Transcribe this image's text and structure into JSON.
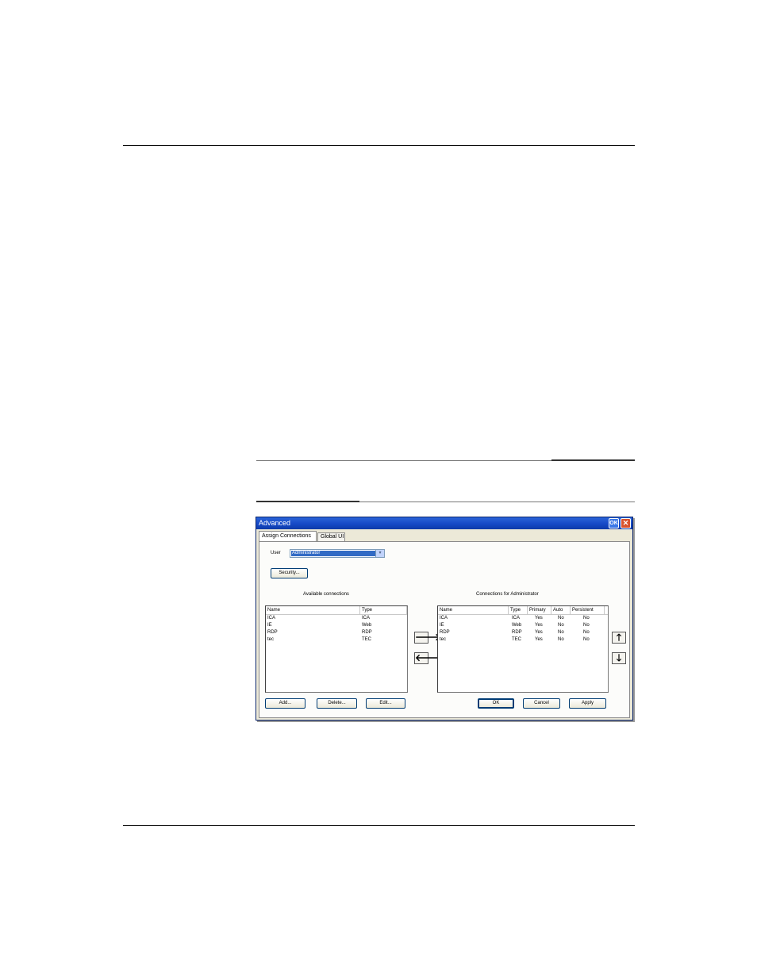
{
  "dialog": {
    "title": "Advanced",
    "ok_label": "OK",
    "close_label": "✕",
    "tabs": [
      {
        "label": "Assign Connections",
        "active": true
      },
      {
        "label": "Global UI",
        "active": false
      }
    ],
    "user_label": "User",
    "user_value": "Administrator",
    "security_button": "Security...",
    "available_caption": "Available connections",
    "assigned_caption": "Connections for Administrator",
    "available": {
      "columns": [
        "Name",
        "Type"
      ],
      "rows": [
        [
          "ICA",
          "ICA"
        ],
        [
          "IE",
          "Web"
        ],
        [
          "RDP",
          "RDP"
        ],
        [
          "tec",
          "TEC"
        ]
      ]
    },
    "assigned": {
      "columns": [
        "Name",
        "Type",
        "Primary",
        "Auto",
        "Persistent"
      ],
      "rows": [
        [
          "ICA",
          "ICA",
          "Yes",
          "No",
          "No"
        ],
        [
          "IE",
          "Web",
          "Yes",
          "No",
          "No"
        ],
        [
          "RDP",
          "RDP",
          "Yes",
          "No",
          "No"
        ],
        [
          "tec",
          "TEC",
          "Yes",
          "No",
          "No"
        ]
      ]
    },
    "arrows": {
      "add_to": "🡒",
      "remove_from": "🡐",
      "move_up": "🡑",
      "move_down": "🡓"
    },
    "buttons": {
      "add": "Add...",
      "delete": "Delete...",
      "edit": "Edit...",
      "ok": "OK",
      "cancel": "Cancel",
      "apply": "Apply"
    }
  }
}
